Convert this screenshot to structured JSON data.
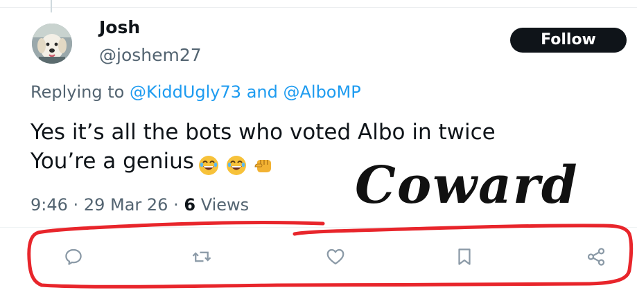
{
  "author": {
    "name": "Josh",
    "handle": "@joshem27",
    "avatar_icon": "dog-avatar"
  },
  "follow_label": "Follow",
  "replying": {
    "prefix": "Replying to",
    "mention1": "@KiddUgly73",
    "conjunction": "and",
    "mention2": "@AlboMP"
  },
  "tweet": {
    "line1": "Yes it’s all the bots who voted Albo in twice",
    "line2": "You’re a genius",
    "emojis": [
      "laughing-emoji",
      "laughing-emoji",
      "pointing-fist-emoji"
    ]
  },
  "meta": {
    "time": "9:46",
    "date": "29 Mar 26",
    "views_count": "6",
    "views_label": "Views",
    "separator": "·"
  },
  "annotation": {
    "text": "Coward",
    "scribble_color": "#e8252b"
  },
  "actions": [
    "reply-icon",
    "retweet-icon",
    "like-icon",
    "bookmark-icon",
    "share-icon"
  ],
  "colors": {
    "link": "#1d9bf0",
    "muted": "#536471",
    "text": "#0f1419",
    "button_bg": "#0f1419"
  }
}
